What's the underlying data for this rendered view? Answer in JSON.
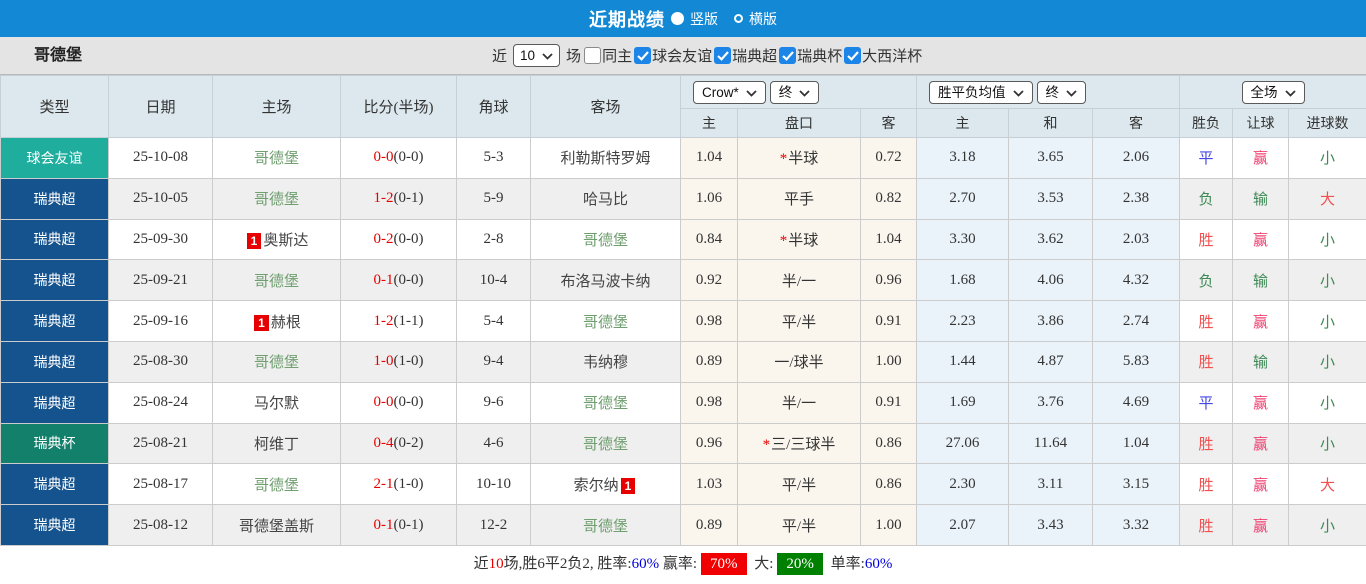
{
  "header": {
    "title": "近期战绩",
    "view_options": [
      {
        "label": "竖版",
        "selected": true
      },
      {
        "label": "横版",
        "selected": false
      }
    ]
  },
  "filterbar": {
    "team_name": "哥德堡",
    "recent_label": "近",
    "recent_count": "10",
    "games_label": "场",
    "checkboxes": [
      {
        "label": "同主",
        "checked": false
      },
      {
        "label": "球会友谊",
        "checked": true
      },
      {
        "label": "瑞典超",
        "checked": true
      },
      {
        "label": "瑞典杯",
        "checked": true
      },
      {
        "label": "大西洋杯",
        "checked": true
      }
    ]
  },
  "table": {
    "team": "哥德堡",
    "main_headers": [
      "类型",
      "日期",
      "主场",
      "比分(半场)",
      "角球",
      "客场"
    ],
    "sub_headers": [
      "主",
      "盘口",
      "客",
      "主",
      "和",
      "客",
      "胜负",
      "让球",
      "进球数"
    ],
    "selects": {
      "odds_source": "Crow*",
      "odds_stage": "终",
      "avg_source": "胜平负均值",
      "avg_stage": "终",
      "scope": "全场"
    },
    "rows": [
      {
        "type": "球会友谊",
        "date": "25-10-08",
        "home": "哥德堡",
        "home_card": false,
        "score": "0-0",
        "half": "(0-0)",
        "corners": "5-3",
        "away": "利勒斯特罗姆",
        "away_card": false,
        "odds_home": "1.04",
        "handicap": "半球",
        "handicap_star": true,
        "odds_away": "0.72",
        "avg_home": "3.18",
        "avg_draw": "3.65",
        "avg_away": "2.06",
        "result": "平",
        "handicap_result": "赢",
        "goals": "小"
      },
      {
        "type": "瑞典超",
        "date": "25-10-05",
        "home": "哥德堡",
        "home_card": false,
        "score": "1-2",
        "half": "(0-1)",
        "corners": "5-9",
        "away": "哈马比",
        "away_card": false,
        "odds_home": "1.06",
        "handicap": "平手",
        "handicap_star": false,
        "odds_away": "0.82",
        "avg_home": "2.70",
        "avg_draw": "3.53",
        "avg_away": "2.38",
        "result": "负",
        "handicap_result": "输",
        "goals": "大"
      },
      {
        "type": "瑞典超",
        "date": "25-09-30",
        "home": "奥斯达",
        "home_card": true,
        "score": "0-2",
        "half": "(0-0)",
        "corners": "2-8",
        "away": "哥德堡",
        "away_card": false,
        "odds_home": "0.84",
        "handicap": "半球",
        "handicap_star": true,
        "odds_away": "1.04",
        "avg_home": "3.30",
        "avg_draw": "3.62",
        "avg_away": "2.03",
        "result": "胜",
        "handicap_result": "赢",
        "goals": "小"
      },
      {
        "type": "瑞典超",
        "date": "25-09-21",
        "home": "哥德堡",
        "home_card": false,
        "score": "0-1",
        "half": "(0-0)",
        "corners": "10-4",
        "away": "布洛马波卡纳",
        "away_card": false,
        "odds_home": "0.92",
        "handicap": "半/一",
        "handicap_star": false,
        "odds_away": "0.96",
        "avg_home": "1.68",
        "avg_draw": "4.06",
        "avg_away": "4.32",
        "result": "负",
        "handicap_result": "输",
        "goals": "小"
      },
      {
        "type": "瑞典超",
        "date": "25-09-16",
        "home": "赫根",
        "home_card": true,
        "score": "1-2",
        "half": "(1-1)",
        "corners": "5-4",
        "away": "哥德堡",
        "away_card": false,
        "odds_home": "0.98",
        "handicap": "平/半",
        "handicap_star": false,
        "odds_away": "0.91",
        "avg_home": "2.23",
        "avg_draw": "3.86",
        "avg_away": "2.74",
        "result": "胜",
        "handicap_result": "赢",
        "goals": "小"
      },
      {
        "type": "瑞典超",
        "date": "25-08-30",
        "home": "哥德堡",
        "home_card": false,
        "score": "1-0",
        "half": "(1-0)",
        "corners": "9-4",
        "away": "韦纳穆",
        "away_card": false,
        "odds_home": "0.89",
        "handicap": "一/球半",
        "handicap_star": false,
        "odds_away": "1.00",
        "avg_home": "1.44",
        "avg_draw": "4.87",
        "avg_away": "5.83",
        "result": "胜",
        "handicap_result": "输",
        "goals": "小"
      },
      {
        "type": "瑞典超",
        "date": "25-08-24",
        "home": "马尔默",
        "home_card": false,
        "score": "0-0",
        "half": "(0-0)",
        "corners": "9-6",
        "away": "哥德堡",
        "away_card": false,
        "odds_home": "0.98",
        "handicap": "半/一",
        "handicap_star": false,
        "odds_away": "0.91",
        "avg_home": "1.69",
        "avg_draw": "3.76",
        "avg_away": "4.69",
        "result": "平",
        "handicap_result": "赢",
        "goals": "小"
      },
      {
        "type": "瑞典杯",
        "date": "25-08-21",
        "home": "柯维丁",
        "home_card": false,
        "score": "0-4",
        "half": "(0-2)",
        "corners": "4-6",
        "away": "哥德堡",
        "away_card": false,
        "odds_home": "0.96",
        "handicap": "三/三球半",
        "handicap_star": true,
        "odds_away": "0.86",
        "avg_home": "27.06",
        "avg_draw": "11.64",
        "avg_away": "1.04",
        "result": "胜",
        "handicap_result": "赢",
        "goals": "小"
      },
      {
        "type": "瑞典超",
        "date": "25-08-17",
        "home": "哥德堡",
        "home_card": false,
        "score": "2-1",
        "half": "(1-0)",
        "corners": "10-10",
        "away": "索尔纳",
        "away_card": true,
        "odds_home": "1.03",
        "handicap": "平/半",
        "handicap_star": false,
        "odds_away": "0.86",
        "avg_home": "2.30",
        "avg_draw": "3.11",
        "avg_away": "3.15",
        "result": "胜",
        "handicap_result": "赢",
        "goals": "大"
      },
      {
        "type": "瑞典超",
        "date": "25-08-12",
        "home": "哥德堡盖斯",
        "home_card": false,
        "score": "0-1",
        "half": "(0-1)",
        "corners": "12-2",
        "away": "哥德堡",
        "away_card": false,
        "odds_home": "0.89",
        "handicap": "平/半",
        "handicap_star": false,
        "odds_away": "1.00",
        "avg_home": "2.07",
        "avg_draw": "3.43",
        "avg_away": "3.32",
        "result": "胜",
        "handicap_result": "赢",
        "goals": "小"
      }
    ]
  },
  "footer": {
    "segments": [
      {
        "text": "近",
        "style": "plain"
      },
      {
        "text": "10",
        "style": "red-text"
      },
      {
        "text": "场,胜6平2负2, 胜率:",
        "style": "plain"
      },
      {
        "text": "60%",
        "style": "blue-text"
      },
      {
        "text": " 赢率:",
        "style": "plain"
      },
      {
        "text": "70%",
        "style": "red-badge"
      },
      {
        "text": " 大:",
        "style": "plain"
      },
      {
        "text": "20%",
        "style": "green-badge"
      },
      {
        "text": " 单率:",
        "style": "plain"
      },
      {
        "text": "60%",
        "style": "blue-text"
      }
    ]
  },
  "colors": {
    "topbar": "#1389d6",
    "checkbox_blue": "#1d85e8",
    "type_colors": {
      "球会友谊": "#1fae9e",
      "瑞典超": "#15538e",
      "瑞典杯": "#13806c"
    },
    "value_colors": {
      "胜": "#f05050",
      "平": "#4545e5",
      "负": "#3e8a55",
      "赢": "#ee3f6f",
      "输": "#3e8a55",
      "大": "#f05050",
      "小": "#3e8a55"
    },
    "team_green": "#6f9e6f",
    "opponent_text": "#444444",
    "score_red": "#e60000",
    "card_red": "#e60000"
  }
}
